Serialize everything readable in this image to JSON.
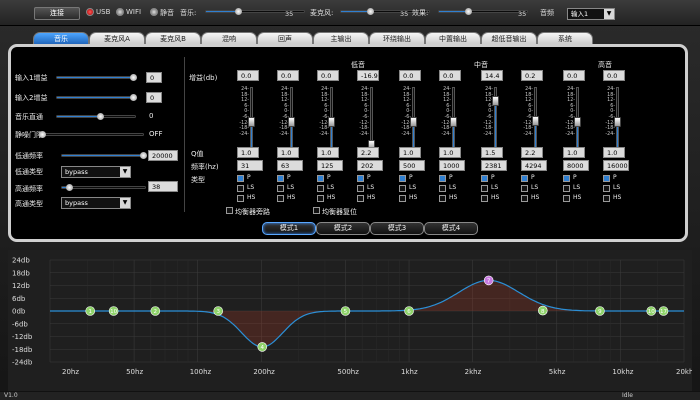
{
  "top": {
    "connect": "连接",
    "usb": "USB",
    "wifi": "WIFI",
    "mute": "静音",
    "music_label": "音乐:",
    "music_value": "35",
    "music_level": 0.33,
    "mic_label": "麦克风:",
    "mic_value": "35",
    "mic_level": 0.33,
    "effect_label": "效果:",
    "effect_value": "35",
    "effect_level": 0.33,
    "source_label": "音频",
    "source_value": "输入1"
  },
  "tabs": [
    "音乐",
    "麦克风A",
    "麦克风B",
    "混响",
    "回声",
    "主输出",
    "环绕输出",
    "中置输出",
    "超低音输出",
    "系统"
  ],
  "left": {
    "in1_gain_label": "输入1增益",
    "in1_gain": "0",
    "in1_gain_level": 0.98,
    "in2_gain_label": "输入2增益",
    "in2_gain": "0",
    "in2_gain_level": 0.98,
    "music_path_label": "音乐直通",
    "music_path": "0",
    "music_path_level": 0.55,
    "noise_gate_label": "静噪门限",
    "noise_gate": "OFF",
    "noise_gate_level": 0.02,
    "low_freq_label": "低通频率",
    "low_freq": "20000",
    "low_freq_level": 0.98,
    "low_type_label": "低通类型",
    "low_type": "bypass",
    "high_freq_label": "高通频率",
    "high_freq": "38",
    "high_freq_level": 0.08,
    "high_type_label": "高通类型",
    "high_type": "bypass"
  },
  "eq": {
    "gain_label": "增益(db)",
    "q_label": "Q值",
    "freq_label": "频率(hz)",
    "type_label": "类型",
    "low_label": "低音",
    "mid_label": "中音",
    "high_label": "高音",
    "scale": "24-\n18-\n12-\n6-\n0-\n-6-\n-12-\n-18-\n-24-",
    "p_label": "P",
    "ls_label": "LS",
    "hs_label": "HS",
    "bypass_label": "均衡器旁路",
    "reset_label": "均衡器复位",
    "bands": [
      {
        "gain": "0.0",
        "q": "1.0",
        "freq": "31",
        "gain_db": 0
      },
      {
        "gain": "0.0",
        "q": "1.0",
        "freq": "63",
        "gain_db": 0
      },
      {
        "gain": "0.0",
        "q": "1.0",
        "freq": "125",
        "gain_db": 0
      },
      {
        "gain": "-16.9",
        "q": "2.2",
        "freq": "202",
        "gain_db": -16.9
      },
      {
        "gain": "0.0",
        "q": "1.0",
        "freq": "500",
        "gain_db": 0
      },
      {
        "gain": "0.0",
        "q": "1.0",
        "freq": "1000",
        "gain_db": 0
      },
      {
        "gain": "14.4",
        "q": "1.5",
        "freq": "2381",
        "gain_db": 14.4
      },
      {
        "gain": "0.2",
        "q": "2.2",
        "freq": "4294",
        "gain_db": 0.2
      },
      {
        "gain": "0.0",
        "q": "1.0",
        "freq": "8000",
        "gain_db": 0
      },
      {
        "gain": "0.0",
        "q": "1.0",
        "freq": "16000",
        "gain_db": 0
      }
    ]
  },
  "modes": [
    "模式1",
    "模式2",
    "模式3",
    "模式4"
  ],
  "graph": {
    "ylabels": [
      "24db",
      "18db",
      "12db",
      "6db",
      "0db",
      "-6db",
      "-12db",
      "-18db",
      "-24db"
    ],
    "xlabels": [
      "20hz",
      "50hz",
      "100hz",
      "200hz",
      "500hz",
      "1khz",
      "2khz",
      "5khz",
      "10khz",
      "20khz"
    ],
    "points": [
      {
        "n": "1",
        "f": 31,
        "db": 0
      },
      {
        "n": "10",
        "f": 40,
        "db": 0
      },
      {
        "n": "2",
        "f": 63,
        "db": 0
      },
      {
        "n": "3",
        "f": 125,
        "db": 0
      },
      {
        "n": "4",
        "f": 202,
        "db": -16.9
      },
      {
        "n": "5",
        "f": 500,
        "db": 0
      },
      {
        "n": "6",
        "f": 1000,
        "db": 0
      },
      {
        "n": "7",
        "f": 2381,
        "db": 14.4
      },
      {
        "n": "8",
        "f": 4294,
        "db": 0.2
      },
      {
        "n": "9",
        "f": 8000,
        "db": 0
      },
      {
        "n": "10",
        "f": 14000,
        "db": 0
      },
      {
        "n": "17",
        "f": 16000,
        "db": 0
      }
    ],
    "colors": {
      "line": "#2b8fd6",
      "node": "#8fd36a",
      "node7": "#c779e0",
      "grid": "#3a3a3a"
    }
  },
  "status": {
    "version": "V1.0",
    "state": "Idle"
  }
}
